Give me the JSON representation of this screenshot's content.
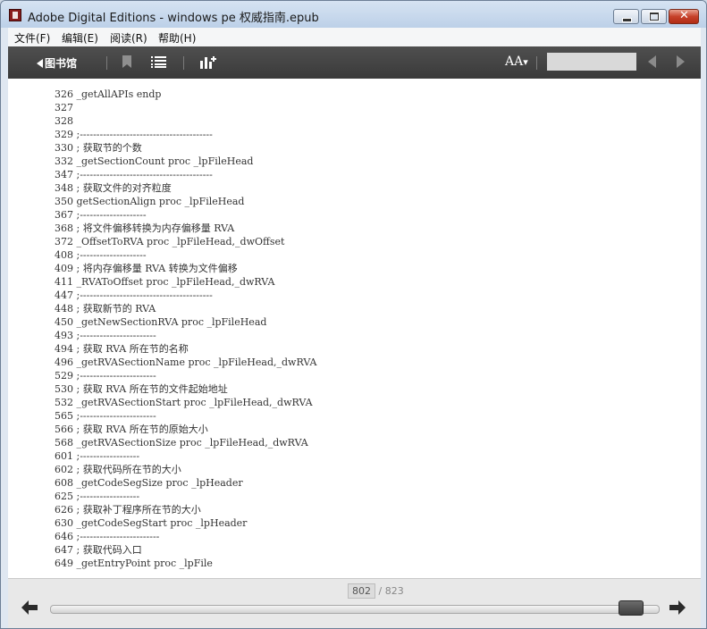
{
  "window": {
    "title": "Adobe Digital Editions - windows pe 权威指南.epub",
    "accent_close": "#c6402a"
  },
  "menu": {
    "items": [
      "文件(F)",
      "编辑(E)",
      "阅读(R)",
      "帮助(H)"
    ]
  },
  "toolbar": {
    "library_label": "图书馆",
    "font_size_label": "AA",
    "search_value": ""
  },
  "content": {
    "lines": [
      "326 _getAllAPIs endp",
      "327",
      "328",
      "329 ;----------------------------------------",
      "330 ; 获取节的个数",
      "332 _getSectionCount proc _lpFileHead",
      "347 ;----------------------------------------",
      "348 ; 获取文件的对齐粒度",
      "350 getSectionAlign proc _lpFileHead",
      "367 ;--------------------",
      "368 ; 将文件偏移转换为内存偏移量 RVA",
      "372 _OffsetToRVA proc _lpFileHead,_dwOffset",
      "408 ;--------------------",
      "409 ; 将内存偏移量 RVA 转换为文件偏移",
      "411 _RVAToOffset proc _lpFileHead,_dwRVA",
      "447 ;----------------------------------------",
      "448 ; 获取新节的 RVA",
      "450 _getNewSectionRVA proc _lpFileHead",
      "493 ;-----------------------",
      "494 ; 获取 RVA 所在节的名称",
      "496 _getRVASectionName proc _lpFileHead,_dwRVA",
      "529 ;-----------------------",
      "530 ; 获取 RVA 所在节的文件起始地址",
      "532 _getRVASectionStart proc _lpFileHead,_dwRVA",
      "565 ;-----------------------",
      "566 ; 获取 RVA 所在节的原始大小",
      "568 _getRVASectionSize proc _lpFileHead,_dwRVA",
      "601 ;------------------",
      "602 ; 获取代码所在节的大小",
      "608 _getCodeSegSize proc _lpHeader",
      "625 ;------------------",
      "626 ; 获取补丁程序所在节的大小",
      "630 _getCodeSegStart proc _lpHeader",
      "646 ;------------------------",
      "647 ; 获取代码入口",
      "649 _getEntryPoint proc _lpFile"
    ]
  },
  "footer": {
    "current_page": "802",
    "total_pages": "/ 823",
    "progress_fraction": 0.975
  }
}
